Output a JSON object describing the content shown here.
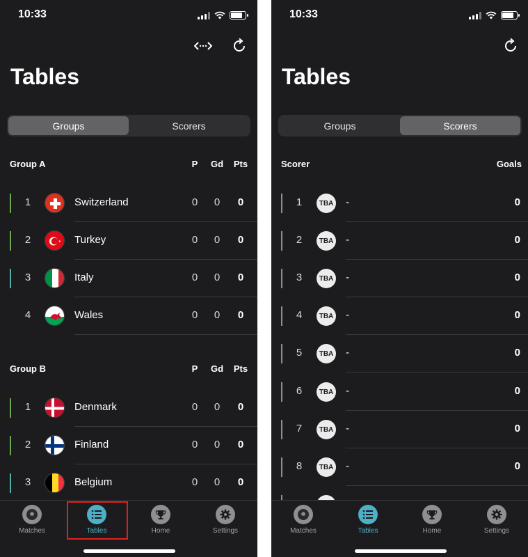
{
  "colors": {
    "background": "#1c1c1e",
    "accent": "#4db0c6",
    "qualify_bar": "#6aa84f",
    "third_bar": "#4fb3a9",
    "scorer_bar": "#8e8e93",
    "highlight": "#e02020"
  },
  "status_bar": {
    "time": "10:33"
  },
  "page": {
    "title": "Tables"
  },
  "segments": [
    "Groups",
    "Scorers"
  ],
  "groups": [
    {
      "name": "Group A",
      "columns": {
        "played": "P",
        "goal_diff": "Gd",
        "points": "Pts"
      },
      "teams": [
        {
          "pos": "1",
          "name": "Switzerland",
          "flag": "switzerland-flag",
          "p": "0",
          "gd": "0",
          "pts": "0",
          "status": "qualify"
        },
        {
          "pos": "2",
          "name": "Turkey",
          "flag": "turkey-flag",
          "p": "0",
          "gd": "0",
          "pts": "0",
          "status": "qualify"
        },
        {
          "pos": "3",
          "name": "Italy",
          "flag": "italy-flag",
          "p": "0",
          "gd": "0",
          "pts": "0",
          "status": "third"
        },
        {
          "pos": "4",
          "name": "Wales",
          "flag": "wales-flag",
          "p": "0",
          "gd": "0",
          "pts": "0",
          "status": "none"
        }
      ]
    },
    {
      "name": "Group B",
      "columns": {
        "played": "P",
        "goal_diff": "Gd",
        "points": "Pts"
      },
      "teams": [
        {
          "pos": "1",
          "name": "Denmark",
          "flag": "denmark-flag",
          "p": "0",
          "gd": "0",
          "pts": "0",
          "status": "qualify"
        },
        {
          "pos": "2",
          "name": "Finland",
          "flag": "finland-flag",
          "p": "0",
          "gd": "0",
          "pts": "0",
          "status": "qualify"
        },
        {
          "pos": "3",
          "name": "Belgium",
          "flag": "belgium-flag",
          "p": "0",
          "gd": "0",
          "pts": "0",
          "status": "third"
        }
      ]
    }
  ],
  "scorers": {
    "columns": {
      "scorer": "Scorer",
      "goals": "Goals"
    },
    "rows": [
      {
        "pos": "1",
        "badge": "TBA",
        "name": "-",
        "goals": "0"
      },
      {
        "pos": "2",
        "badge": "TBA",
        "name": "-",
        "goals": "0"
      },
      {
        "pos": "3",
        "badge": "TBA",
        "name": "-",
        "goals": "0"
      },
      {
        "pos": "4",
        "badge": "TBA",
        "name": "-",
        "goals": "0"
      },
      {
        "pos": "5",
        "badge": "TBA",
        "name": "-",
        "goals": "0"
      },
      {
        "pos": "6",
        "badge": "TBA",
        "name": "-",
        "goals": "0"
      },
      {
        "pos": "7",
        "badge": "TBA",
        "name": "-",
        "goals": "0"
      },
      {
        "pos": "8",
        "badge": "TBA",
        "name": "-",
        "goals": "0"
      }
    ]
  },
  "tabbar": [
    {
      "label": "Matches",
      "icon": "soccer-ball-icon"
    },
    {
      "label": "Tables",
      "icon": "list-icon"
    },
    {
      "label": "Home",
      "icon": "trophy-icon"
    },
    {
      "label": "Settings",
      "icon": "gear-icon"
    }
  ]
}
